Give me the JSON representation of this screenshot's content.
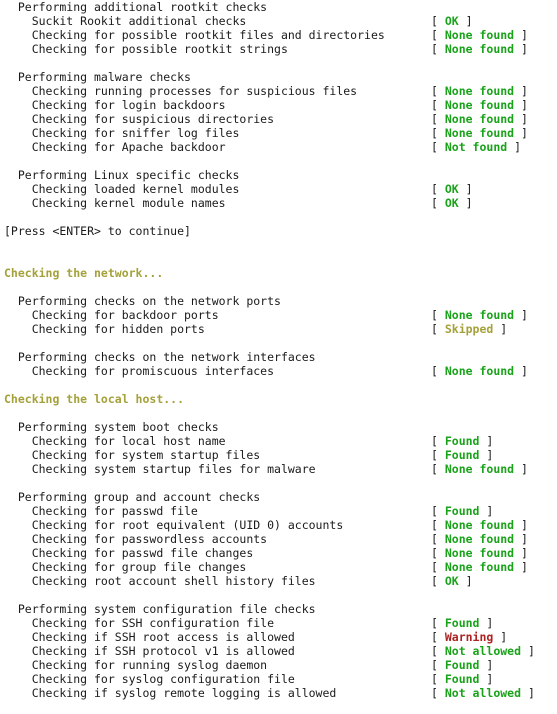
{
  "terminal": {
    "app": "rkhunter system check output",
    "background_color": "#ffffff",
    "text_color": "#1a1a1a",
    "colors": {
      "green": "#1aa31a",
      "red": "#ad2121",
      "olive": "#a5a13a",
      "plain": "#1a1a1a"
    },
    "prompt_line": "[Press <ENTER> to continue]",
    "lines": [
      {
        "type": "group",
        "text": "  Performing additional rootkit checks"
      },
      {
        "type": "check",
        "text": "    Suckit Rookit additional checks",
        "status": "OK",
        "status_color": "green"
      },
      {
        "type": "check",
        "text": "    Checking for possible rootkit files and directories",
        "status": "None found",
        "status_color": "green"
      },
      {
        "type": "check",
        "text": "    Checking for possible rootkit strings",
        "status": "None found",
        "status_color": "green"
      },
      {
        "type": "blank",
        "text": ""
      },
      {
        "type": "group",
        "text": "  Performing malware checks"
      },
      {
        "type": "check",
        "text": "    Checking running processes for suspicious files",
        "status": "None found",
        "status_color": "green"
      },
      {
        "type": "check",
        "text": "    Checking for login backdoors",
        "status": "None found",
        "status_color": "green"
      },
      {
        "type": "check",
        "text": "    Checking for suspicious directories",
        "status": "None found",
        "status_color": "green"
      },
      {
        "type": "check",
        "text": "    Checking for sniffer log files",
        "status": "None found",
        "status_color": "green"
      },
      {
        "type": "check",
        "text": "    Checking for Apache backdoor",
        "status": "Not found",
        "status_color": "green"
      },
      {
        "type": "blank",
        "text": ""
      },
      {
        "type": "group",
        "text": "  Performing Linux specific checks"
      },
      {
        "type": "check",
        "text": "    Checking loaded kernel modules",
        "status": "OK",
        "status_color": "green"
      },
      {
        "type": "check",
        "text": "    Checking kernel module names",
        "status": "OK",
        "status_color": "green"
      },
      {
        "type": "blank",
        "text": ""
      },
      {
        "type": "prompt",
        "text": "[Press <ENTER> to continue]"
      },
      {
        "type": "blank",
        "text": ""
      },
      {
        "type": "blank",
        "text": ""
      },
      {
        "type": "header",
        "text": "Checking the network..."
      },
      {
        "type": "blank",
        "text": ""
      },
      {
        "type": "group",
        "text": "  Performing checks on the network ports"
      },
      {
        "type": "check",
        "text": "    Checking for backdoor ports",
        "status": "None found",
        "status_color": "green"
      },
      {
        "type": "check",
        "text": "    Checking for hidden ports",
        "status": "Skipped",
        "status_color": "olive"
      },
      {
        "type": "blank",
        "text": ""
      },
      {
        "type": "group",
        "text": "  Performing checks on the network interfaces"
      },
      {
        "type": "check",
        "text": "    Checking for promiscuous interfaces",
        "status": "None found",
        "status_color": "green"
      },
      {
        "type": "blank",
        "text": ""
      },
      {
        "type": "header",
        "text": "Checking the local host..."
      },
      {
        "type": "blank",
        "text": ""
      },
      {
        "type": "group",
        "text": "  Performing system boot checks"
      },
      {
        "type": "check",
        "text": "    Checking for local host name",
        "status": "Found",
        "status_color": "green"
      },
      {
        "type": "check",
        "text": "    Checking for system startup files",
        "status": "Found",
        "status_color": "green"
      },
      {
        "type": "check",
        "text": "    Checking system startup files for malware",
        "status": "None found",
        "status_color": "green"
      },
      {
        "type": "blank",
        "text": ""
      },
      {
        "type": "group",
        "text": "  Performing group and account checks"
      },
      {
        "type": "check",
        "text": "    Checking for passwd file",
        "status": "Found",
        "status_color": "green"
      },
      {
        "type": "check",
        "text": "    Checking for root equivalent (UID 0) accounts",
        "status": "None found",
        "status_color": "green"
      },
      {
        "type": "check",
        "text": "    Checking for passwordless accounts",
        "status": "None found",
        "status_color": "green"
      },
      {
        "type": "check",
        "text": "    Checking for passwd file changes",
        "status": "None found",
        "status_color": "green"
      },
      {
        "type": "check",
        "text": "    Checking for group file changes",
        "status": "None found",
        "status_color": "green"
      },
      {
        "type": "check",
        "text": "    Checking root account shell history files",
        "status": "OK",
        "status_color": "green"
      },
      {
        "type": "blank",
        "text": ""
      },
      {
        "type": "group",
        "text": "  Performing system configuration file checks"
      },
      {
        "type": "check",
        "text": "    Checking for SSH configuration file",
        "status": "Found",
        "status_color": "green"
      },
      {
        "type": "check",
        "text": "    Checking if SSH root access is allowed",
        "status": "Warning",
        "status_color": "red"
      },
      {
        "type": "check",
        "text": "    Checking if SSH protocol v1 is allowed",
        "status": "Not allowed",
        "status_color": "green"
      },
      {
        "type": "check",
        "text": "    Checking for running syslog daemon",
        "status": "Found",
        "status_color": "green"
      },
      {
        "type": "check",
        "text": "    Checking for syslog configuration file",
        "status": "Found",
        "status_color": "green"
      },
      {
        "type": "check",
        "text": "    Checking if syslog remote logging is allowed",
        "status": "Not allowed",
        "status_color": "green"
      }
    ]
  }
}
